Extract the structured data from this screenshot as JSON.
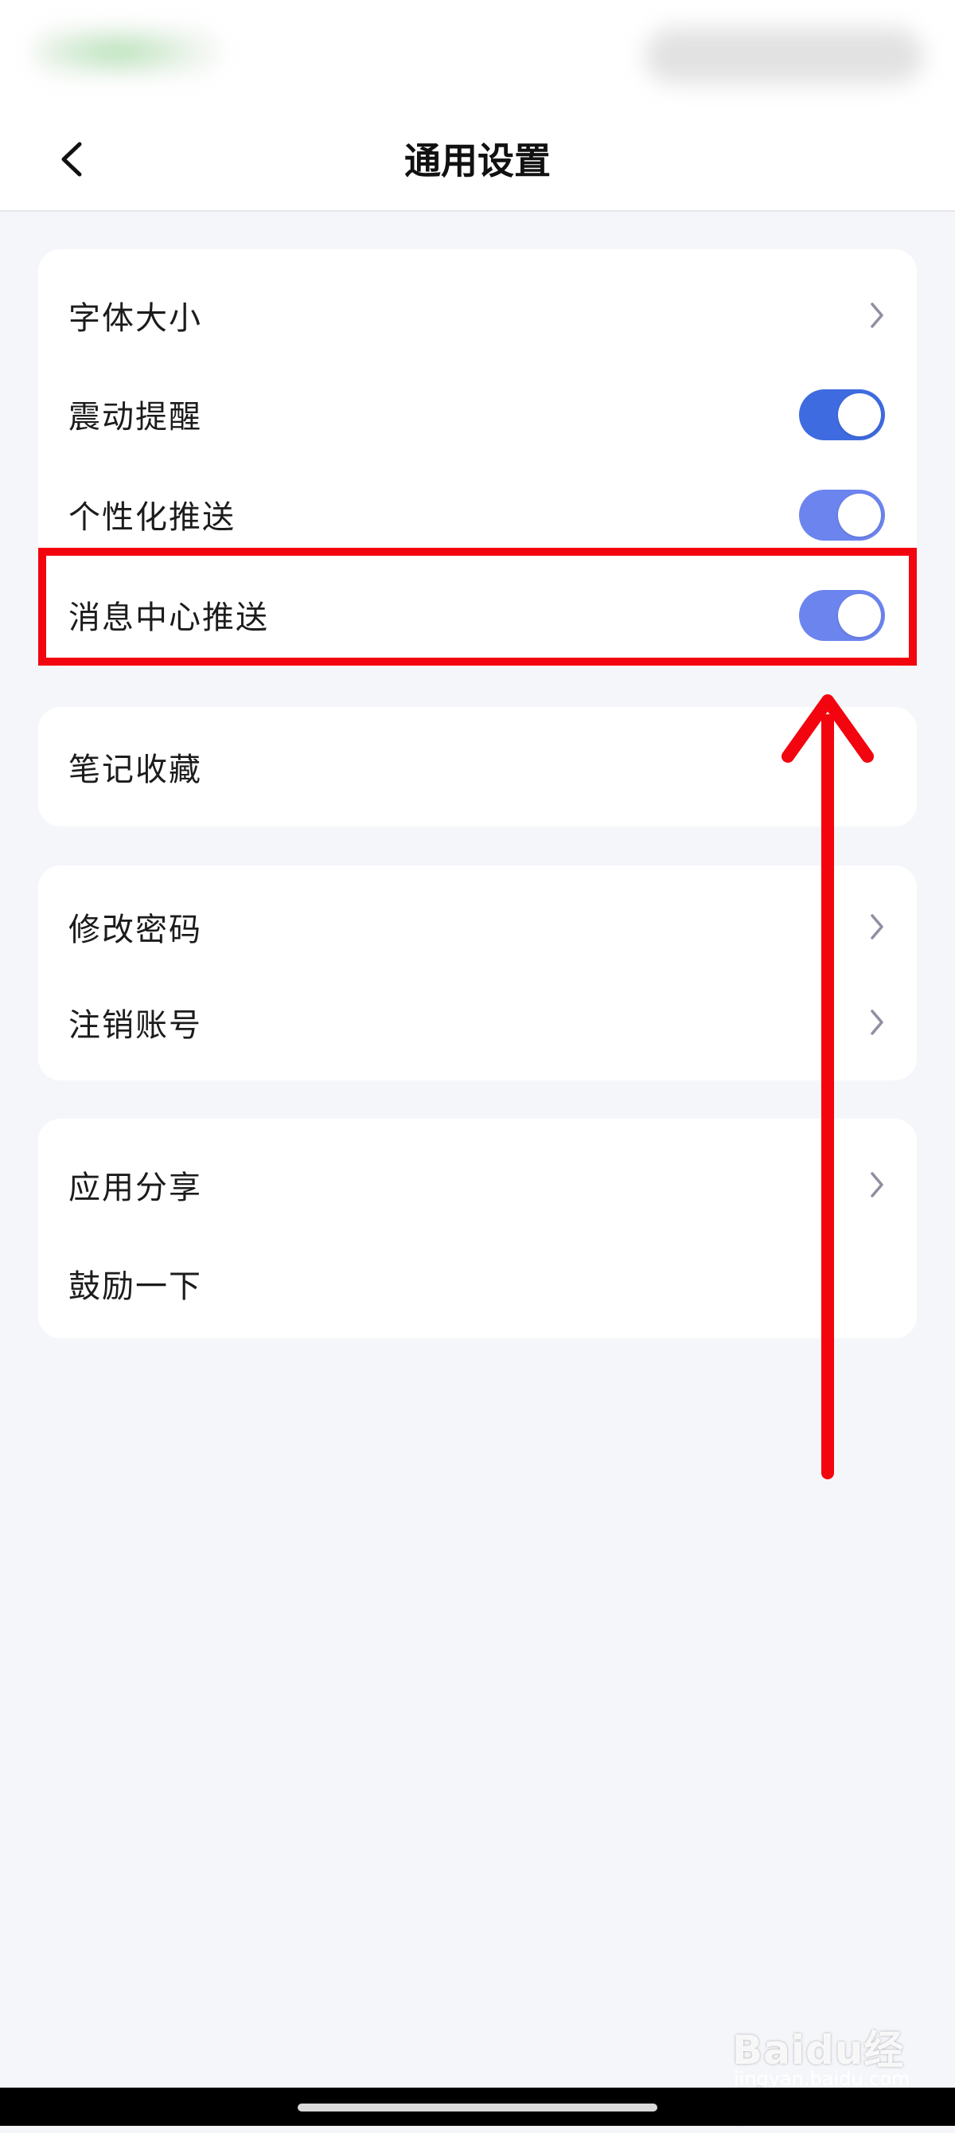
{
  "header": {
    "title": "通用设置",
    "back_icon": "chevron-left-icon"
  },
  "groups": [
    {
      "items": [
        {
          "label": "字体大小",
          "control": "chevron"
        },
        {
          "label": "震动提醒",
          "control": "toggle",
          "on": true
        },
        {
          "label": "个性化推送",
          "control": "toggle",
          "on": true
        },
        {
          "label": "消息中心推送",
          "control": "toggle",
          "on": true
        }
      ]
    },
    {
      "items": [
        {
          "label": "笔记收藏",
          "control": "none"
        }
      ]
    },
    {
      "items": [
        {
          "label": "修改密码",
          "control": "chevron"
        },
        {
          "label": "注销账号",
          "control": "chevron"
        }
      ]
    },
    {
      "items": [
        {
          "label": "应用分享",
          "control": "chevron"
        },
        {
          "label": "鼓励一下",
          "control": "none"
        }
      ]
    }
  ],
  "colors": {
    "toggle_on_dark": "#3f6be0",
    "toggle_on_light": "#6c84ee",
    "annotation_red": "#f2050f",
    "background": "#f5f6fa"
  },
  "watermark": {
    "brand": "Baidu经验",
    "url": "jingyan.baidu.com"
  }
}
